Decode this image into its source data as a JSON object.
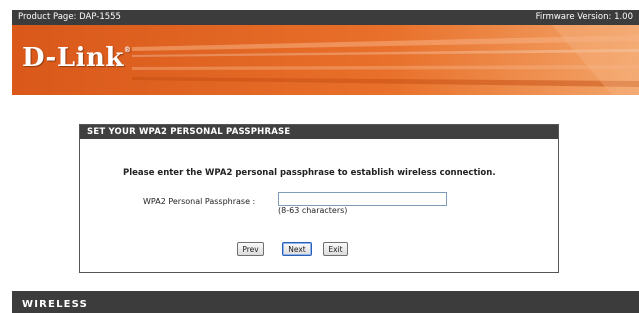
{
  "header": {
    "product_page": "Product Page: DAP-1555",
    "firmware_version": "Firmware Version: 1.00",
    "brand_logo": "D-Link"
  },
  "wizard": {
    "title": "SET YOUR WPA2 PERSONAL PASSPHRASE",
    "instruction": "Please enter the WPA2 personal passphrase to establish wireless connection.",
    "passphrase_label": "WPA2 Personal Passphrase :",
    "passphrase_value": "",
    "passphrase_hint": "(8-63 characters)",
    "buttons": {
      "prev": "Prev",
      "next": "Next",
      "exit": "Exit"
    }
  },
  "footer": {
    "label": "WIRELESS"
  },
  "colors": {
    "banner_orange": "#e0601c",
    "bar_dark": "#3c3c3c"
  }
}
